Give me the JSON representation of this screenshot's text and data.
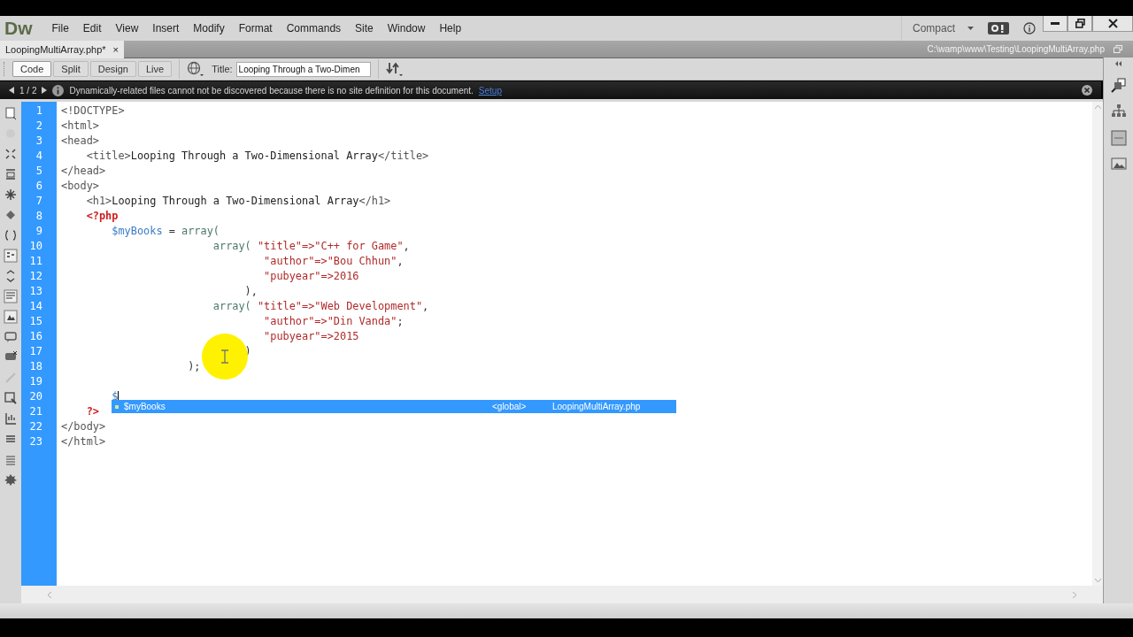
{
  "app": {
    "logo": "Dw",
    "menu": [
      "File",
      "Edit",
      "View",
      "Insert",
      "Modify",
      "Format",
      "Commands",
      "Site",
      "Window",
      "Help"
    ],
    "workspace": "Compact"
  },
  "document_tab": {
    "label": "LoopingMultiArray.php*",
    "close": "×",
    "path": "C:\\wamp\\www\\Testing\\LoopingMultiArray.php"
  },
  "view_buttons": [
    {
      "label": "Code",
      "selected": true
    },
    {
      "label": "Split",
      "selected": false
    },
    {
      "label": "Design",
      "selected": false
    },
    {
      "label": "Live",
      "selected": false
    }
  ],
  "title_field": {
    "label": "Title:",
    "value": "Looping Through a Two-Dimen"
  },
  "info_bar": {
    "pager": "1 / 2",
    "message": "Dynamically-related files cannot not be discovered because there is no site definition for this document.",
    "link": "Setup"
  },
  "code_lines": [
    {
      "number": "1",
      "segments": [
        {
          "kind": "tag",
          "text": "<!DOCTYPE>"
        }
      ]
    },
    {
      "number": "2",
      "segments": [
        {
          "kind": "tag",
          "text": "<html>"
        }
      ]
    },
    {
      "number": "3",
      "segments": [
        {
          "kind": "tag",
          "text": "<head>"
        }
      ]
    },
    {
      "number": "4",
      "segments": [
        {
          "kind": "tag",
          "text": "    <title>"
        },
        {
          "kind": "text",
          "text": "Looping Through a Two-Dimensional Array"
        },
        {
          "kind": "tag",
          "text": "</title>"
        }
      ]
    },
    {
      "number": "5",
      "segments": [
        {
          "kind": "tag",
          "text": "</head>"
        }
      ]
    },
    {
      "number": "6",
      "segments": [
        {
          "kind": "tag",
          "text": "<body>"
        }
      ]
    },
    {
      "number": "7",
      "segments": [
        {
          "kind": "tag",
          "text": "    <h1>"
        },
        {
          "kind": "text",
          "text": "Looping Through a Two-Dimensional Array"
        },
        {
          "kind": "tag",
          "text": "</h1>"
        }
      ]
    },
    {
      "number": "8",
      "segments": [
        {
          "kind": "php",
          "text": "    <?php"
        }
      ]
    },
    {
      "number": "9",
      "segments": [
        {
          "kind": "var",
          "text": "        $myBooks"
        },
        {
          "kind": "punct",
          "text": " = "
        },
        {
          "kind": "func",
          "text": "array("
        }
      ]
    },
    {
      "number": "10",
      "segments": [
        {
          "kind": "func",
          "text": "                        array( "
        },
        {
          "kind": "string",
          "text": "\"title\"=>\"C++ for Game\""
        },
        {
          "kind": "punct",
          "text": ","
        }
      ]
    },
    {
      "number": "11",
      "segments": [
        {
          "kind": "string",
          "text": "                                \"author\"=>\"Bou Chhun\""
        },
        {
          "kind": "punct",
          "text": ","
        }
      ]
    },
    {
      "number": "12",
      "segments": [
        {
          "kind": "string",
          "text": "                                \"pubyear\"=>2016"
        }
      ]
    },
    {
      "number": "13",
      "segments": [
        {
          "kind": "punct",
          "text": "                             ),"
        }
      ]
    },
    {
      "number": "14",
      "segments": [
        {
          "kind": "func",
          "text": "                        array( "
        },
        {
          "kind": "string",
          "text": "\"title\"=>\"Web Development\""
        },
        {
          "kind": "punct",
          "text": ","
        }
      ]
    },
    {
      "number": "15",
      "segments": [
        {
          "kind": "string",
          "text": "                                \"author\"=>\"Din Vanda\""
        },
        {
          "kind": "punct",
          "text": ";"
        }
      ]
    },
    {
      "number": "16",
      "segments": [
        {
          "kind": "string",
          "text": "                                \"pubyear\"=>2015"
        }
      ]
    },
    {
      "number": "17",
      "segments": [
        {
          "kind": "punct",
          "text": "                             )"
        }
      ]
    },
    {
      "number": "18",
      "segments": [
        {
          "kind": "punct",
          "text": "                    );"
        }
      ]
    },
    {
      "number": "19"
    },
    {
      "number": "20",
      "segments": [
        {
          "kind": "var",
          "text": "        $"
        }
      ]
    },
    {
      "number": "21",
      "segments": [
        {
          "kind": "php",
          "text": "    ?>"
        }
      ]
    },
    {
      "number": "22",
      "segments": [
        {
          "kind": "tag",
          "text": "</body>"
        }
      ]
    },
    {
      "number": "23",
      "segments": [
        {
          "kind": "tag",
          "text": "</html>"
        }
      ]
    }
  ],
  "autocomplete": {
    "items": [
      {
        "name": "$myBooks",
        "scope": "<global>",
        "file": "LoopingMultiArray.php",
        "selected": true
      }
    ]
  }
}
